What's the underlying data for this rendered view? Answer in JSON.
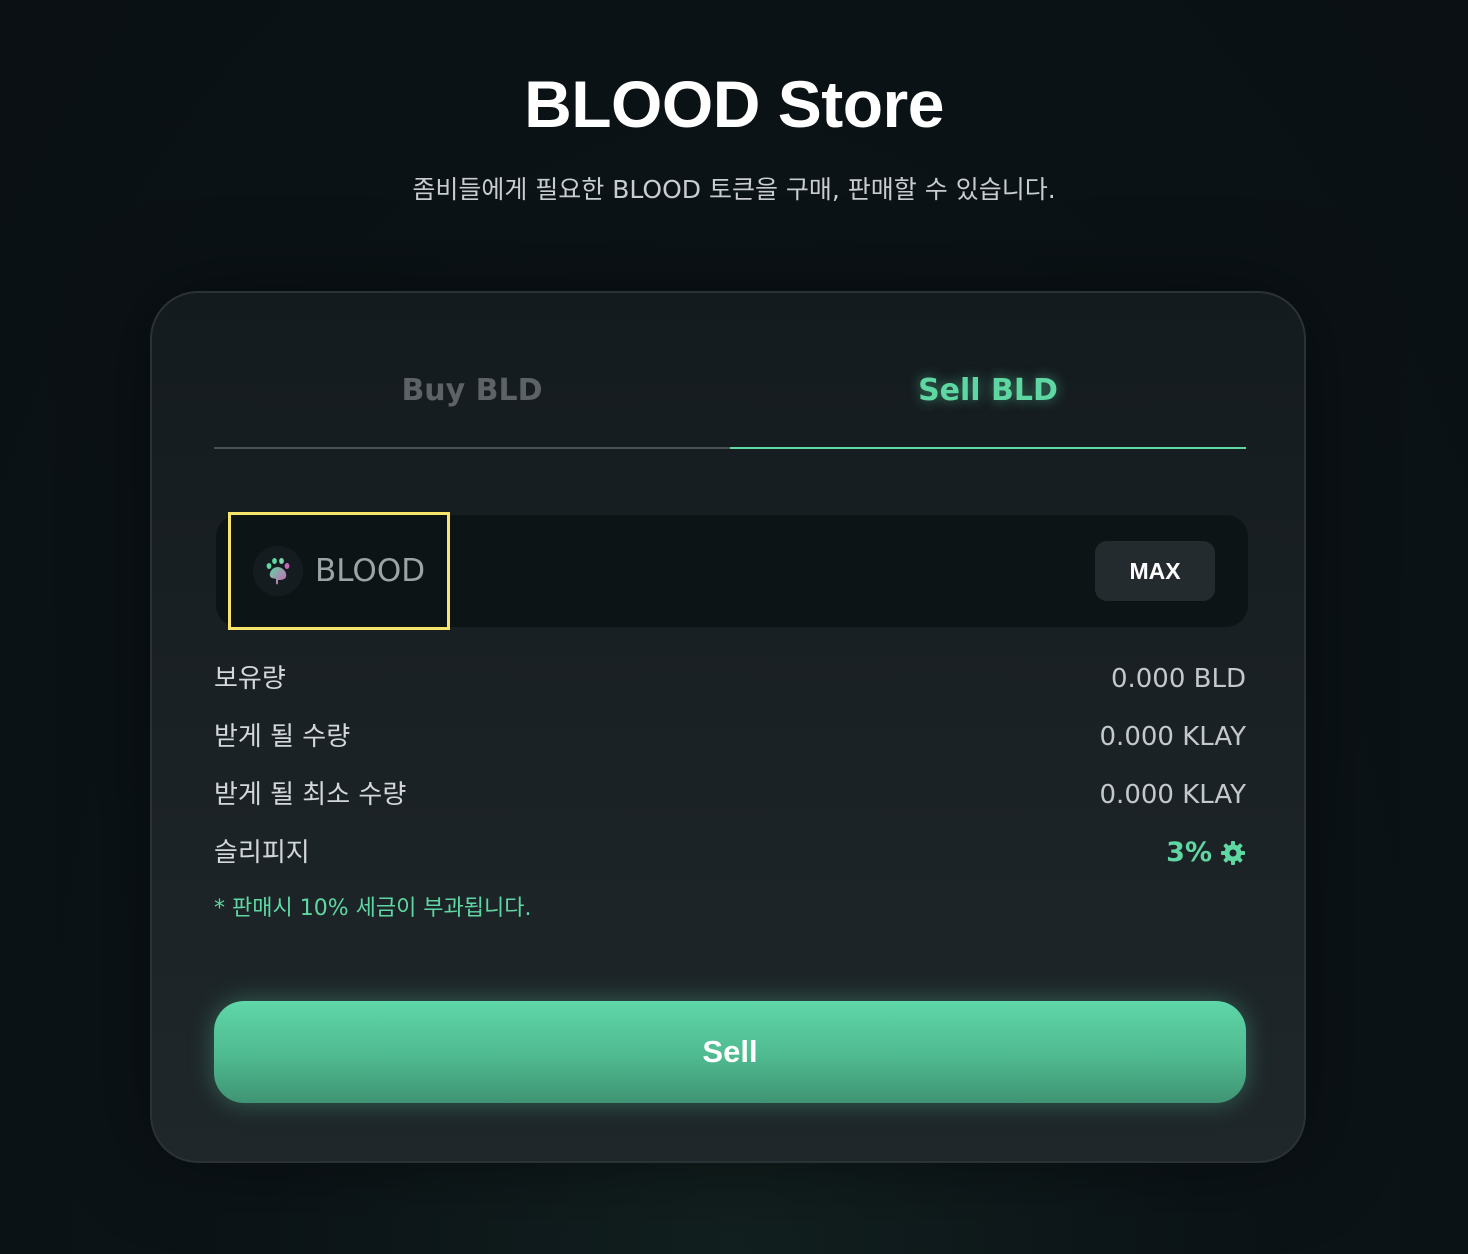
{
  "header": {
    "title": "BLOOD Store",
    "subtitle": "좀비들에게 필요한 BLOOD 토큰을 구매, 판매할 수 있습니다."
  },
  "tabs": [
    {
      "label": "Buy BLD",
      "active": false
    },
    {
      "label": "Sell BLD",
      "active": true
    }
  ],
  "token_input": {
    "token_name": "BLOOD",
    "token_icon": "blood-paw-icon",
    "max_label": "MAX"
  },
  "info_rows": [
    {
      "label": "보유량",
      "value": "0.000 BLD"
    },
    {
      "label": "받게 될 수량",
      "value": "0.000 KLAY"
    },
    {
      "label": "받게 될 최소 수량",
      "value": "0.000 KLAY"
    }
  ],
  "slippage": {
    "label": "슬리피지",
    "value": "3%",
    "icon": "gear-icon"
  },
  "tax_note": "* 판매시 10% 세금이 부과됩니다.",
  "action_button": {
    "label": "Sell"
  },
  "colors": {
    "accent": "#5fd7a2",
    "highlight_border": "#f7e46a",
    "background": "#0c1418",
    "card": "#1b2226"
  }
}
